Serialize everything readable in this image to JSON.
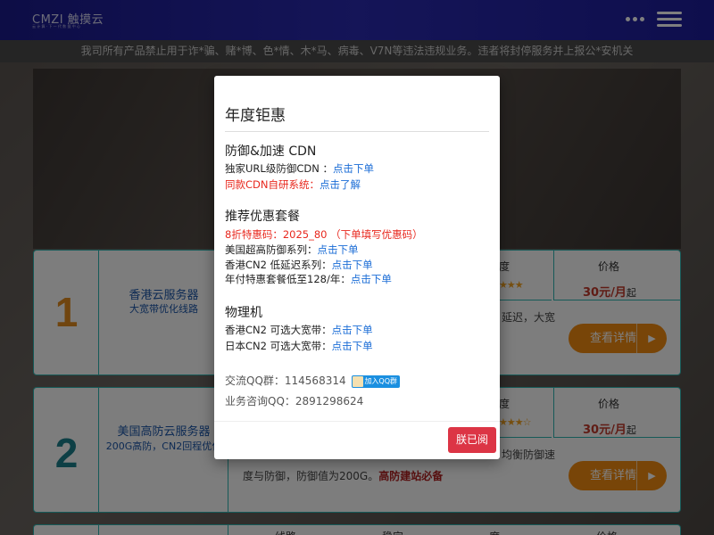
{
  "header": {
    "logo_text": "CMZI 触摸云",
    "logo_tagline": "云 计 算 · 下 一 代 数 据 中 心",
    "more_icon": "ellipsis-icon",
    "menu_icon": "hamburger-menu-icon",
    "background": "#1f1f9e"
  },
  "notice": {
    "text": "我司所有产品禁止用于诈*骗、赌*博、色*情、木*马、病毒、V7N等违法违规业务。违者将封停服务并上报公*安机关"
  },
  "products": [
    {
      "number": "1",
      "number_color": "#e08a1e",
      "name": "香港云服务器",
      "subtitle": "大宽带优化线路",
      "col_head_1": "度",
      "stars": "★★★",
      "price_label": "价格",
      "price": "30元/月",
      "price_suffix": "起",
      "desc_1": "延迟，大宽",
      "detail_label": "查看详情"
    },
    {
      "number": "2",
      "number_color": "#1b7f8a",
      "name": "美国高防云服务器",
      "subtitle": "200G高防，CN2回程优化",
      "col_head_1": "度",
      "stars": "★★★☆",
      "price_label": "价格",
      "price": "30元/月",
      "price_suffix": "起",
      "desc_1": "均衡防御速",
      "desc_2": "度与防御，防御值为200G。",
      "desc_2_highlight": "高防建站必备",
      "detail_label": "查看详情"
    },
    {
      "col_a": "线路",
      "col_b": "稳定",
      "col_c": "度",
      "col_d": "价格"
    }
  ],
  "modal": {
    "title": "年度钜惠",
    "sections": [
      {
        "title": "防御&加速 CDN",
        "lines": [
          {
            "text": "独家URL级防御CDN ：",
            "link": "点击下单",
            "style": "normal"
          },
          {
            "text": "同款CDN自研系统：",
            "link": "点击了解",
            "style": "red"
          }
        ]
      },
      {
        "title": "推荐优惠套餐",
        "lines": [
          {
            "text": "8折特惠码：2025_80 （下单填写优惠码）",
            "link": "",
            "style": "red"
          },
          {
            "text": "美国超高防御系列：",
            "link": "点击下单",
            "style": "normal"
          },
          {
            "text": "香港CN2 低延迟系列：",
            "link": "点击下单",
            "style": "normal"
          },
          {
            "text": "年付特惠套餐低至128/年：",
            "link": "点击下单",
            "style": "normal"
          }
        ]
      },
      {
        "title": "物理机",
        "lines": [
          {
            "text": "香港CN2 可选大宽带：",
            "link": "点击下单",
            "style": "normal"
          },
          {
            "text": "日本CN2 可选大宽带：",
            "link": "点击下单",
            "style": "normal"
          }
        ]
      }
    ],
    "qq_group_label": "交流QQ群：114568314",
    "qq_join_label": "加入QQ群",
    "qq_consult_label": "业务咨询QQ：2891298624",
    "close_label": "朕已阅",
    "close_color": "#dc3545"
  }
}
